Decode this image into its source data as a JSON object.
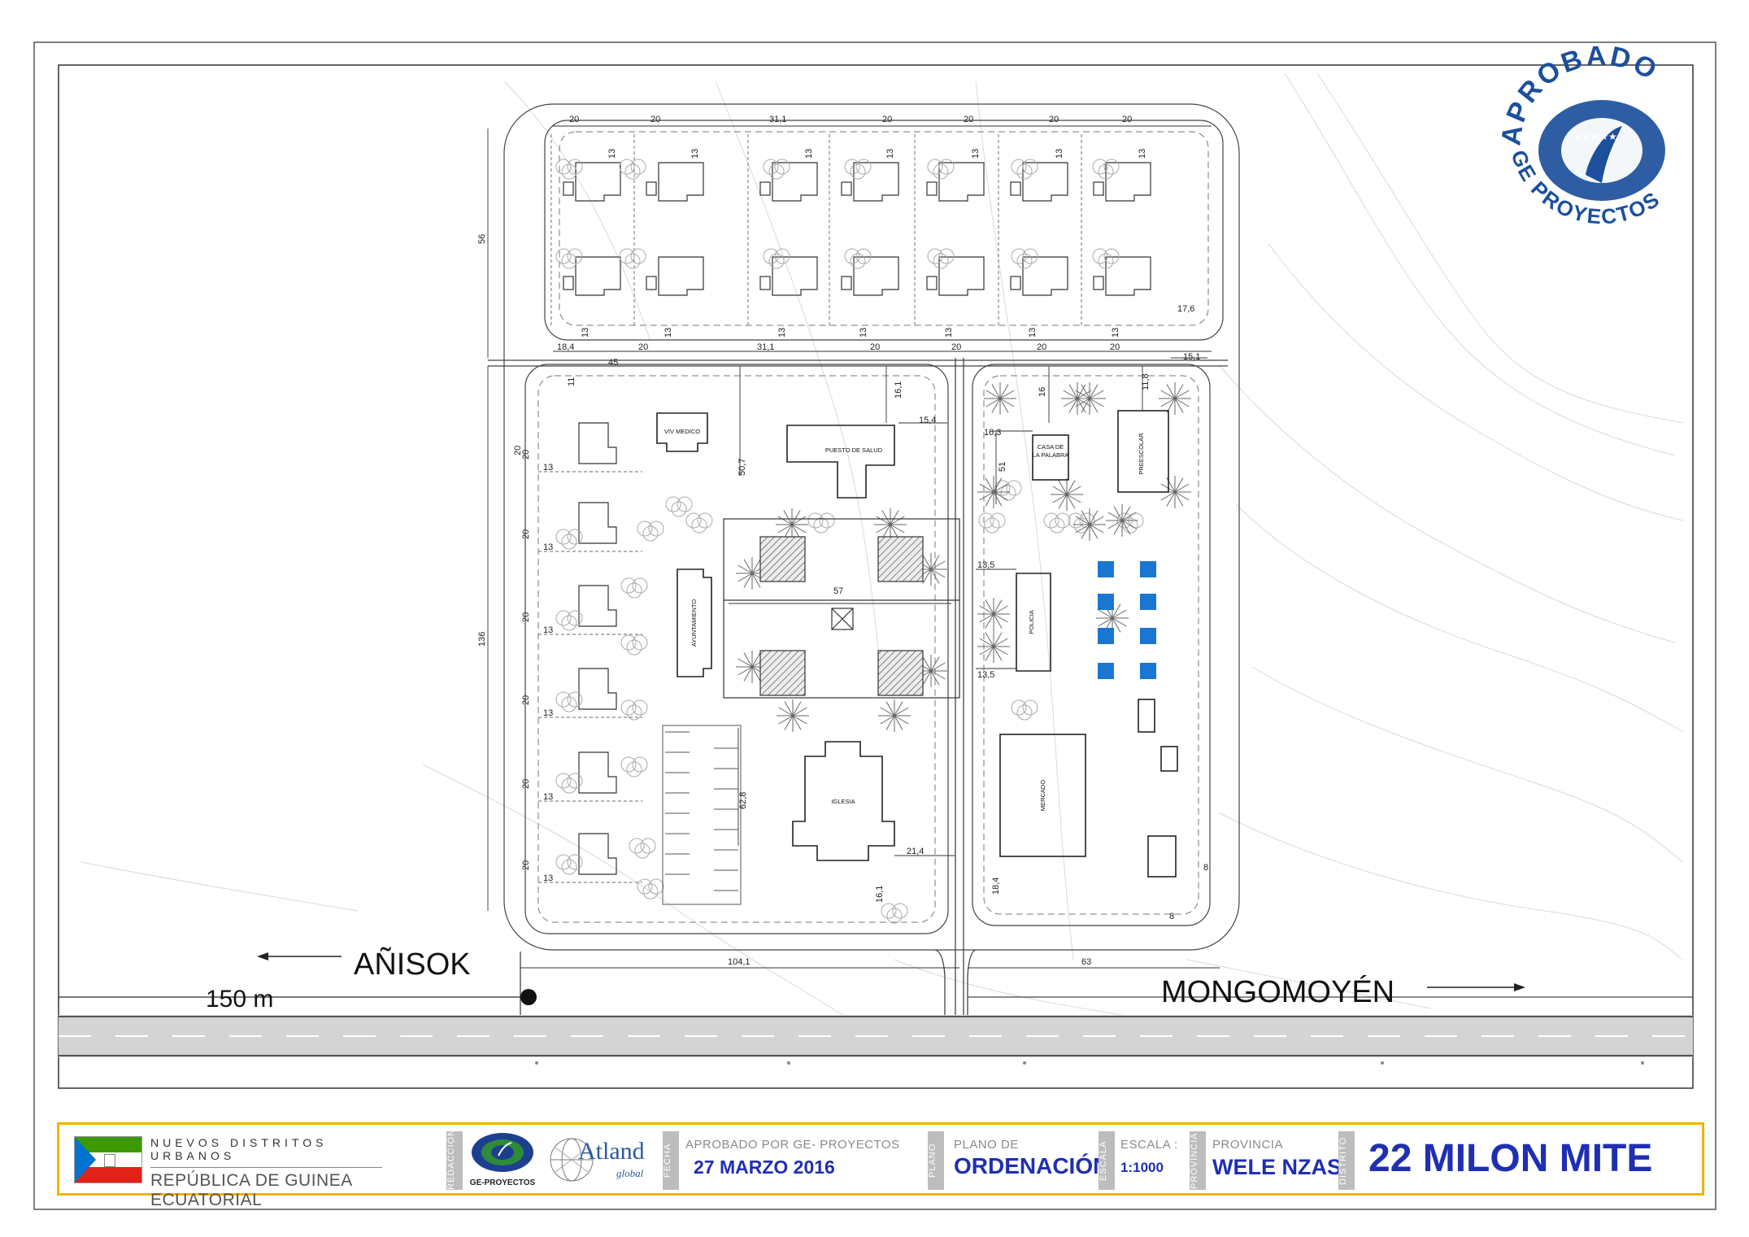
{
  "directions": {
    "west": "AÑISOK",
    "east": "MONGOMOYÉN",
    "distance": "150 m"
  },
  "stamp": {
    "top": "APROBADO",
    "bottom": "GE PROYECTOS"
  },
  "buildings": {
    "viv_medico": "VIV MEDICO",
    "puesto_salud": "PUESTO DE SALUD",
    "casa_palabra_1": "CASA DE",
    "casa_palabra_2": "LA PALABRA",
    "preescolar": "PREESCOLAR",
    "ayuntamiento": "AYUNTAMIENTO",
    "policia": "POLICIA",
    "mercado": "MERCADO",
    "iglesia": "IGLESIA"
  },
  "dimensions": {
    "top_row": [
      "20",
      "20",
      "31,1",
      "20",
      "20",
      "20",
      "20"
    ],
    "bottom_row": [
      "18,4",
      "20",
      "31,1",
      "20",
      "20",
      "20",
      "20"
    ],
    "lot_13": "13",
    "left_56": "56",
    "left_136": "136",
    "d45": "45",
    "d11": "11",
    "d16_1a": "16,1",
    "d15_4": "15,4",
    "d16_3": "16,3",
    "d16": "16",
    "d11_8": "11,8",
    "d15_1": "15,1",
    "d17_6": "17,6",
    "d50_7": "50,7",
    "d51": "51",
    "d57": "57",
    "d13_5a": "13,5",
    "d13_5b": "13,5",
    "d62_8": "62,8",
    "d21_4": "21,4",
    "d16_1b": "16,1",
    "d18_4": "18,4",
    "d8a": "8",
    "d8b": "8",
    "d104_1": "104,1",
    "d63": "63",
    "d20": "20"
  },
  "titleblock": {
    "org_title": "NUEVOS DISTRITOS URBANOS",
    "org_subtitle": "REPÚBLICA DE GUINEA ECUATORIAL",
    "label_redaccion": "REDACCIÓN",
    "ge_logo_text": "GE-PROYECTOS",
    "atland": "Atland",
    "atland_sub": "global",
    "label_fecha": "FECHA",
    "approved_by": "APROBADO POR GE- PROYECTOS",
    "date": "27 MARZO 2016",
    "label_plano": "PLANO",
    "plan_caption": "PLANO DE",
    "plan_name": "ORDENACIÓN",
    "label_escala": "ESCALA",
    "scale_caption": "ESCALA :",
    "scale": "1:1000",
    "label_provincia": "PROVINCIA",
    "province_caption": "PROVINCIA",
    "province": "WELE NZAS",
    "label_distrito": "DISTRITO",
    "district": "22 MILON MITE"
  },
  "colors": {
    "accent_blue": "#1f2fb3",
    "stamp_blue": "#1c4f9c",
    "title_border": "#f0b400",
    "solar_panel": "#1976d2"
  },
  "icons": [
    "north-arrow",
    "ge-proyectos-logo",
    "flag-guinea-ecuatorial",
    "atland-globe-logo",
    "approval-stamp"
  ]
}
